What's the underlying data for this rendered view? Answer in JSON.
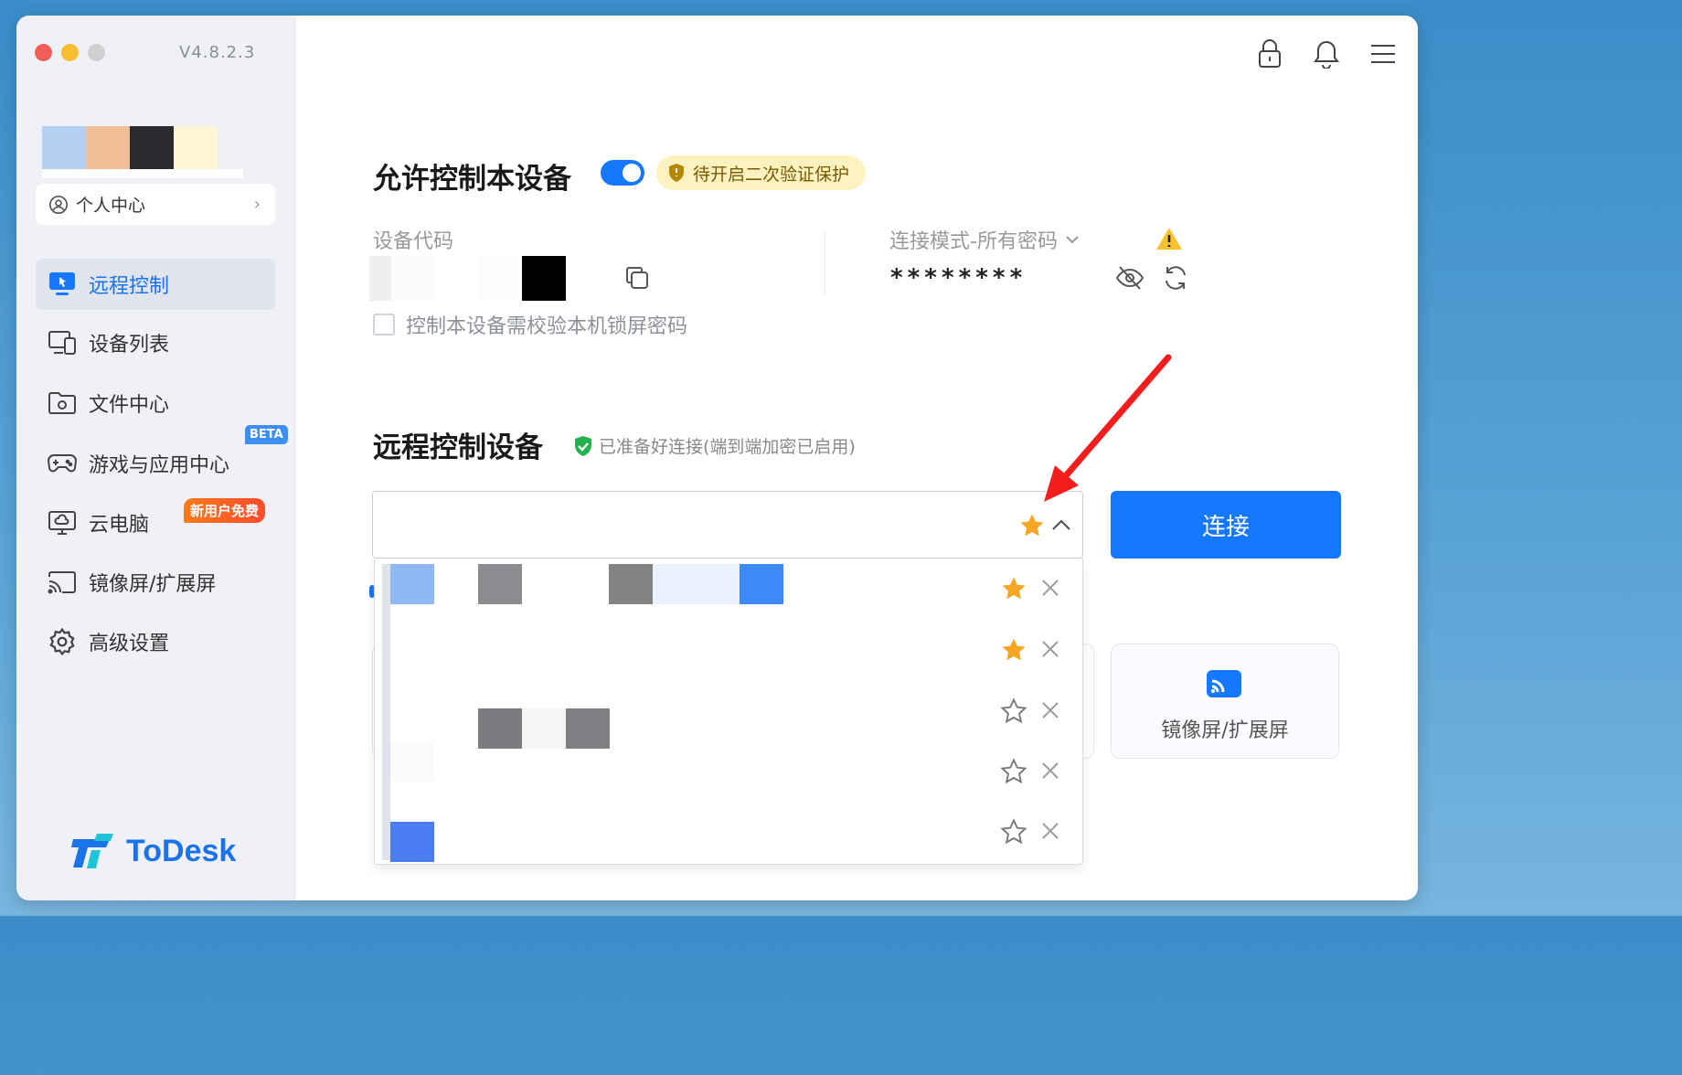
{
  "app": {
    "version": "V4.8.2.3",
    "logo_text": "ToDesk"
  },
  "sidebar": {
    "personal_center": "个人中心",
    "items": [
      {
        "label": "远程控制",
        "icon": "remote-control-icon",
        "active": true
      },
      {
        "label": "设备列表",
        "icon": "device-list-icon",
        "active": false
      },
      {
        "label": "文件中心",
        "icon": "folder-icon",
        "active": false
      },
      {
        "label": "游戏与应用中心",
        "icon": "gamepad-icon",
        "active": false,
        "badge": "BETA"
      },
      {
        "label": "云电脑",
        "icon": "cloud-pc-icon",
        "active": false,
        "badge": "新用户免费"
      },
      {
        "label": "镜像屏/扩展屏",
        "icon": "cast-icon",
        "active": false
      },
      {
        "label": "高级设置",
        "icon": "settings-gear-icon",
        "active": false
      }
    ]
  },
  "allow_control": {
    "title": "允许控制本设备",
    "toggle_on": true,
    "warning_pill": "待开启二次验证保护",
    "device_code_label": "设备代码",
    "connection_mode_label": "连接模式-所有密码",
    "password_masked": "********",
    "lock_screen_checkbox_label": "控制本设备需校验本机锁屏密码",
    "lock_screen_checked": false
  },
  "remote_control": {
    "title": "远程控制设备",
    "status": "已准备好连接(端到端加密已启用)",
    "connect_button": "连接",
    "history_favorites": [
      true,
      true,
      false,
      false,
      false
    ]
  },
  "cards": {
    "mirror_label": "镜像屏/扩展屏"
  },
  "colors": {
    "accent": "#1677ff",
    "star_gold": "#f5a623",
    "ready_green": "#22b14c"
  }
}
